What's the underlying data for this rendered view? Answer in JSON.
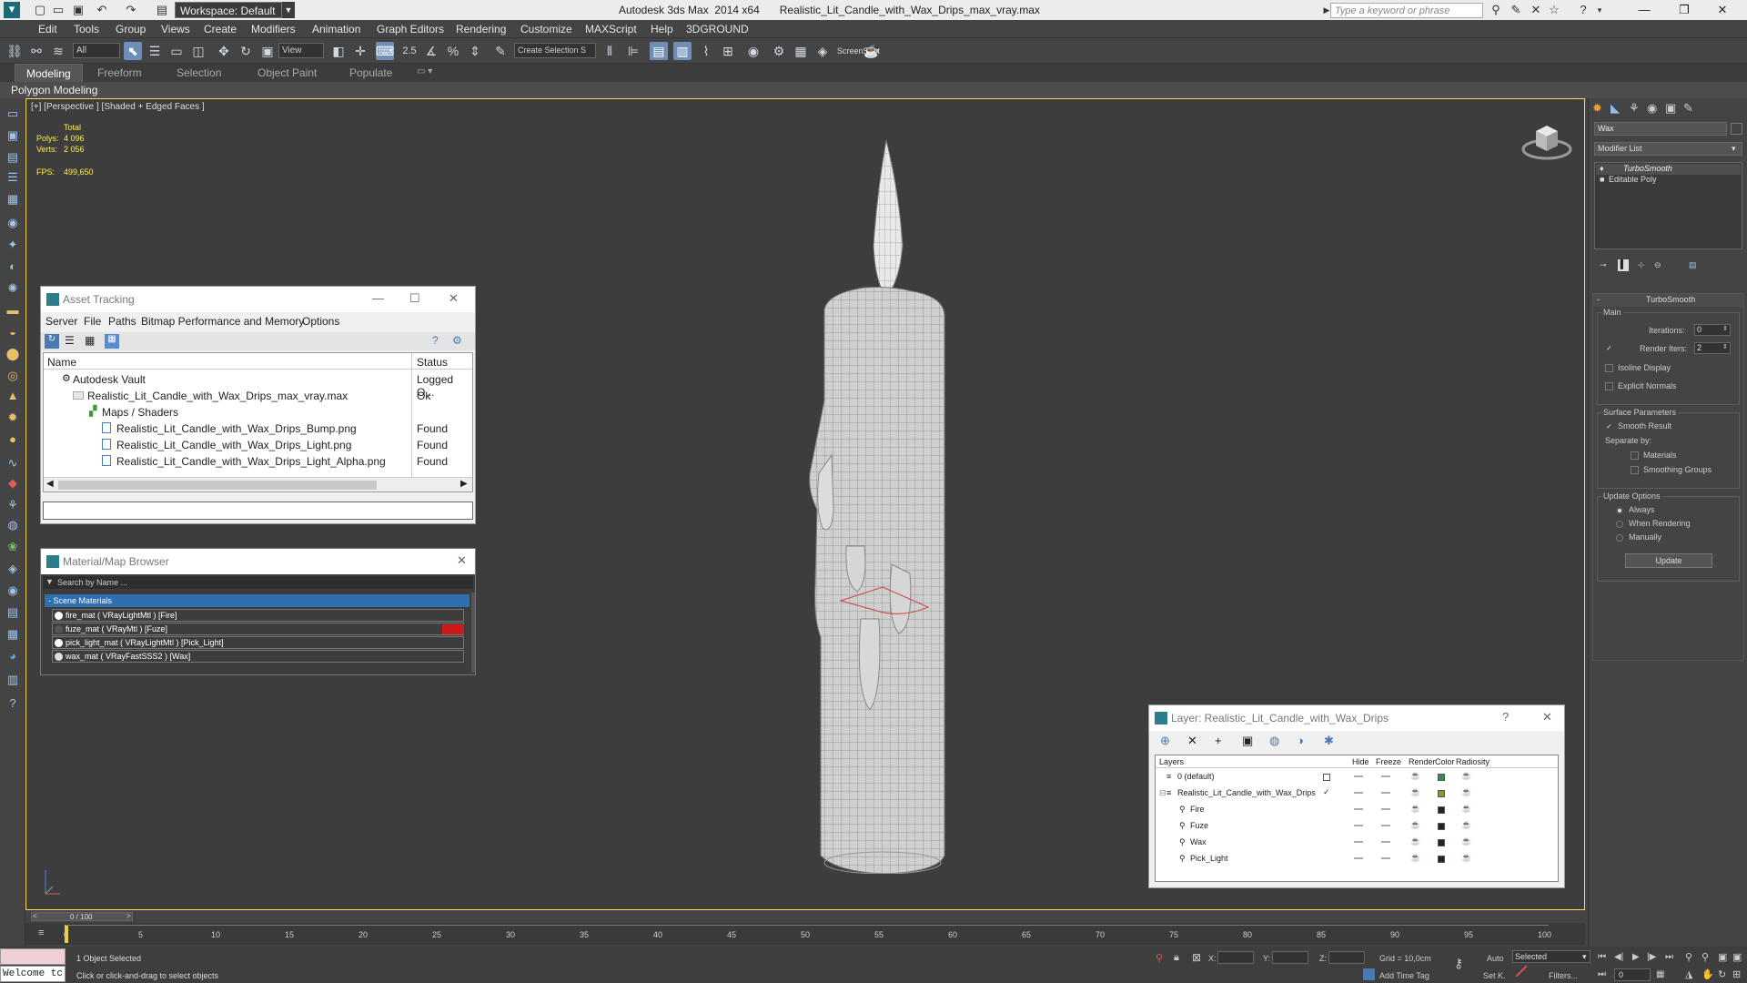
{
  "titlebar": {
    "app": "Autodesk 3ds Max  2014 x64",
    "file": "Realistic_Lit_Candle_with_Wax_Drips_max_vray.max",
    "workspace": "Workspace: Default",
    "search_placeholder": "Type a keyword or phrase"
  },
  "menu": [
    "Edit",
    "Tools",
    "Group",
    "Views",
    "Create",
    "Modifiers",
    "Animation",
    "Graph Editors",
    "Rendering",
    "Customize",
    "MAXScript",
    "Help",
    "3DGROUND"
  ],
  "toolbar": {
    "selection_filter": "All",
    "ref_coord": "View",
    "named_selection": "Create Selection S",
    "screenshot_label": "ScreenShot"
  },
  "ribbon": {
    "tabs": [
      "Modeling",
      "Freeform",
      "Selection",
      "Object Paint",
      "Populate"
    ],
    "sub": "Polygon Modeling"
  },
  "viewport": {
    "label": "[+] [Perspective ] [Shaded + Edged Faces ]",
    "stats": {
      "total_label": "Total",
      "polys_label": "Polys:",
      "polys_value": "4 096",
      "verts_label": "Verts:",
      "verts_value": "2 056",
      "fps_label": "FPS:",
      "fps_value": "499,650"
    }
  },
  "asset_tracking": {
    "title": "Asset Tracking",
    "menu": [
      "Server",
      "File",
      "Paths",
      "Bitmap Performance and Memory",
      "Options"
    ],
    "columns": [
      "Name",
      "Status"
    ],
    "rows": [
      {
        "name": "Autodesk Vault",
        "status": "Logged O..."
      },
      {
        "name": "Realistic_Lit_Candle_with_Wax_Drips_max_vray.max",
        "status": "Ok"
      },
      {
        "name": "Maps / Shaders",
        "status": ""
      },
      {
        "name": "Realistic_Lit_Candle_with_Wax_Drips_Bump.png",
        "status": "Found"
      },
      {
        "name": "Realistic_Lit_Candle_with_Wax_Drips_Light.png",
        "status": "Found"
      },
      {
        "name": "Realistic_Lit_Candle_with_Wax_Drips_Light_Alpha.png",
        "status": "Found"
      }
    ]
  },
  "material_browser": {
    "title": "Material/Map Browser",
    "search_placeholder": "Search by Name ...",
    "group": "- Scene Materials",
    "items": [
      "fire_mat  ( VRayLightMtl ) [Fire]",
      "fuze_mat  ( VRayMtl ) [Fuze]",
      "pick_light_mat  ( VRayLightMtl ) [Pick_Light]",
      "wax_mat  ( VRayFastSSS2 ) [Wax]"
    ]
  },
  "layer_window": {
    "title": "Layer: Realistic_Lit_Candle_with_Wax_Drips",
    "columns": [
      "Layers",
      "Hide",
      "Freeze",
      "Render",
      "Color",
      "Radiosity"
    ],
    "rows": [
      {
        "name": "0 (default)",
        "color": "#3a8a4a"
      },
      {
        "name": "Realistic_Lit_Candle_with_Wax_Drips",
        "color": "#8a9a2a"
      },
      {
        "name": "Fire",
        "color": "#222222"
      },
      {
        "name": "Fuze",
        "color": "#222222"
      },
      {
        "name": "Wax",
        "color": "#222222"
      },
      {
        "name": "Pick_Light",
        "color": "#222222"
      }
    ]
  },
  "command_panel": {
    "object_name": "Wax",
    "modifier_list": "Modifier List",
    "stack": [
      "TurboSmooth",
      "Editable Poly"
    ],
    "rollout_title": "TurboSmooth",
    "main_label": "Main",
    "iterations_label": "Iterations:",
    "iterations_value": "0",
    "render_iters_label": "Render Iters:",
    "render_iters_value": "2",
    "isoline": "Isoline Display",
    "explicit_normals": "Explicit Normals",
    "surface_params": "Surface Parameters",
    "smooth_result": "Smooth Result",
    "separate_by": "Separate by:",
    "materials": "Materials",
    "smoothing_groups": "Smoothing Groups",
    "update_options": "Update Options",
    "always": "Always",
    "when_rendering": "When Rendering",
    "manually": "Manually",
    "update_btn": "Update"
  },
  "timeline": {
    "frame": "0 / 100",
    "ticks": [
      "0",
      "5",
      "10",
      "15",
      "20",
      "25",
      "30",
      "35",
      "40",
      "45",
      "50",
      "55",
      "60",
      "65",
      "70",
      "75",
      "80",
      "85",
      "90",
      "95",
      "100"
    ]
  },
  "status": {
    "welcome": "Welcome tc",
    "selected": "1 Object Selected",
    "prompt": "Click or click-and-drag to select objects",
    "x_label": "X:",
    "y_label": "Y:",
    "z_label": "Z:",
    "grid": "Grid = 10,0cm",
    "add_time_tag": "Add Time Tag",
    "auto": "Auto",
    "set_key": "Set K.",
    "selected_combo": "Selected",
    "filters": "Filters...",
    "frame_value": "0"
  }
}
